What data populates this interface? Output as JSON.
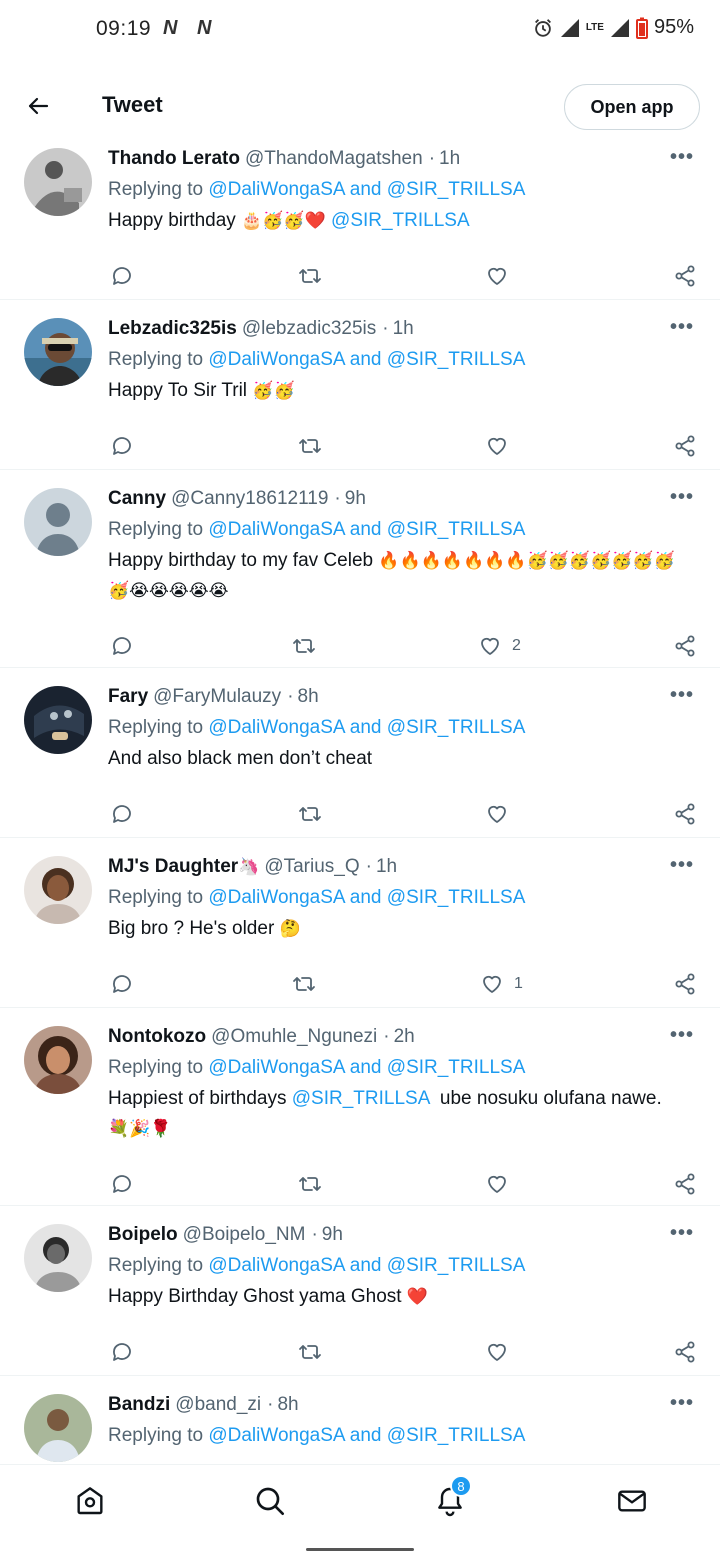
{
  "status": {
    "time": "09:19",
    "notif_icons": [
      "N",
      "N"
    ],
    "network": "LTE",
    "battery": "95%"
  },
  "topbar": {
    "title": "Tweet",
    "open_app": "Open app"
  },
  "tweets": [
    {
      "name": "Thando Lerato",
      "handle": "@ThandoMagatshen",
      "time": "1h",
      "replying_prefix": "Replying to ",
      "replying_to": "@DaliWongaSA and @SIR_TRILLSA",
      "text": "Happy birthday ",
      "emoji": "🎂🥳🥳❤️",
      "mention": " @SIR_TRILLSA",
      "likes": ""
    },
    {
      "name": "Lebzadic325is",
      "handle": "@lebzadic325is",
      "time": "1h",
      "replying_prefix": "Replying to ",
      "replying_to": "@DaliWongaSA and @SIR_TRILLSA",
      "text": "Happy To Sir Tril ",
      "emoji": "🥳🥳",
      "likes": ""
    },
    {
      "name": "Canny",
      "handle": "@Canny18612119",
      "time": "9h",
      "replying_prefix": "Replying to ",
      "replying_to": "@DaliWongaSA and @SIR_TRILLSA",
      "text": "Happy birthday to my fav Celeb ",
      "emoji": "🔥🔥🔥🔥🔥🔥🔥🥳🥳🥳🥳🥳🥳🥳🥳😭😭😭😭😭",
      "likes": "2"
    },
    {
      "name": "Fary",
      "handle": "@FaryMulauzy",
      "time": "8h",
      "replying_prefix": "Replying to ",
      "replying_to": "@DaliWongaSA and @SIR_TRILLSA",
      "text": "And also black men don’t cheat",
      "likes": ""
    },
    {
      "name": "MJ's Daughter",
      "name_emoji": "🦄",
      "handle": "@Tarius_Q",
      "time": "1h",
      "replying_prefix": "Replying to ",
      "replying_to": "@DaliWongaSA and @SIR_TRILLSA",
      "text": "Big bro ? He's older ",
      "emoji": "🤔",
      "likes": "1"
    },
    {
      "name": "Nontokozo",
      "handle": "@Omuhle_Ngunezi",
      "time": "2h",
      "replying_prefix": "Replying to ",
      "replying_to": "@DaliWongaSA and @SIR_TRILLSA",
      "text": "Happiest of birthdays ",
      "mention": "@SIR_TRILLSA",
      "text2": "  ube nosuku olufana nawe. ",
      "emoji": "💐🎉🌹",
      "likes": ""
    },
    {
      "name": "Boipelo",
      "handle": "@Boipelo_NM",
      "time": "9h",
      "replying_prefix": "Replying to ",
      "replying_to": "@DaliWongaSA and @SIR_TRILLSA",
      "text": "Happy Birthday Ghost yama Ghost ",
      "emoji": "❤️",
      "likes": ""
    },
    {
      "name": "Bandzi",
      "handle": "@band_zi",
      "time": "8h",
      "replying_prefix": "Replying to ",
      "replying_to": "@DaliWongaSA and @SIR_TRILLSA",
      "likes": ""
    }
  ],
  "bottom_nav": {
    "notifications_badge": "8"
  },
  "colors": {
    "accent": "#1d9bf0",
    "secondary_text": "#536471",
    "divider": "#eff3f4"
  }
}
